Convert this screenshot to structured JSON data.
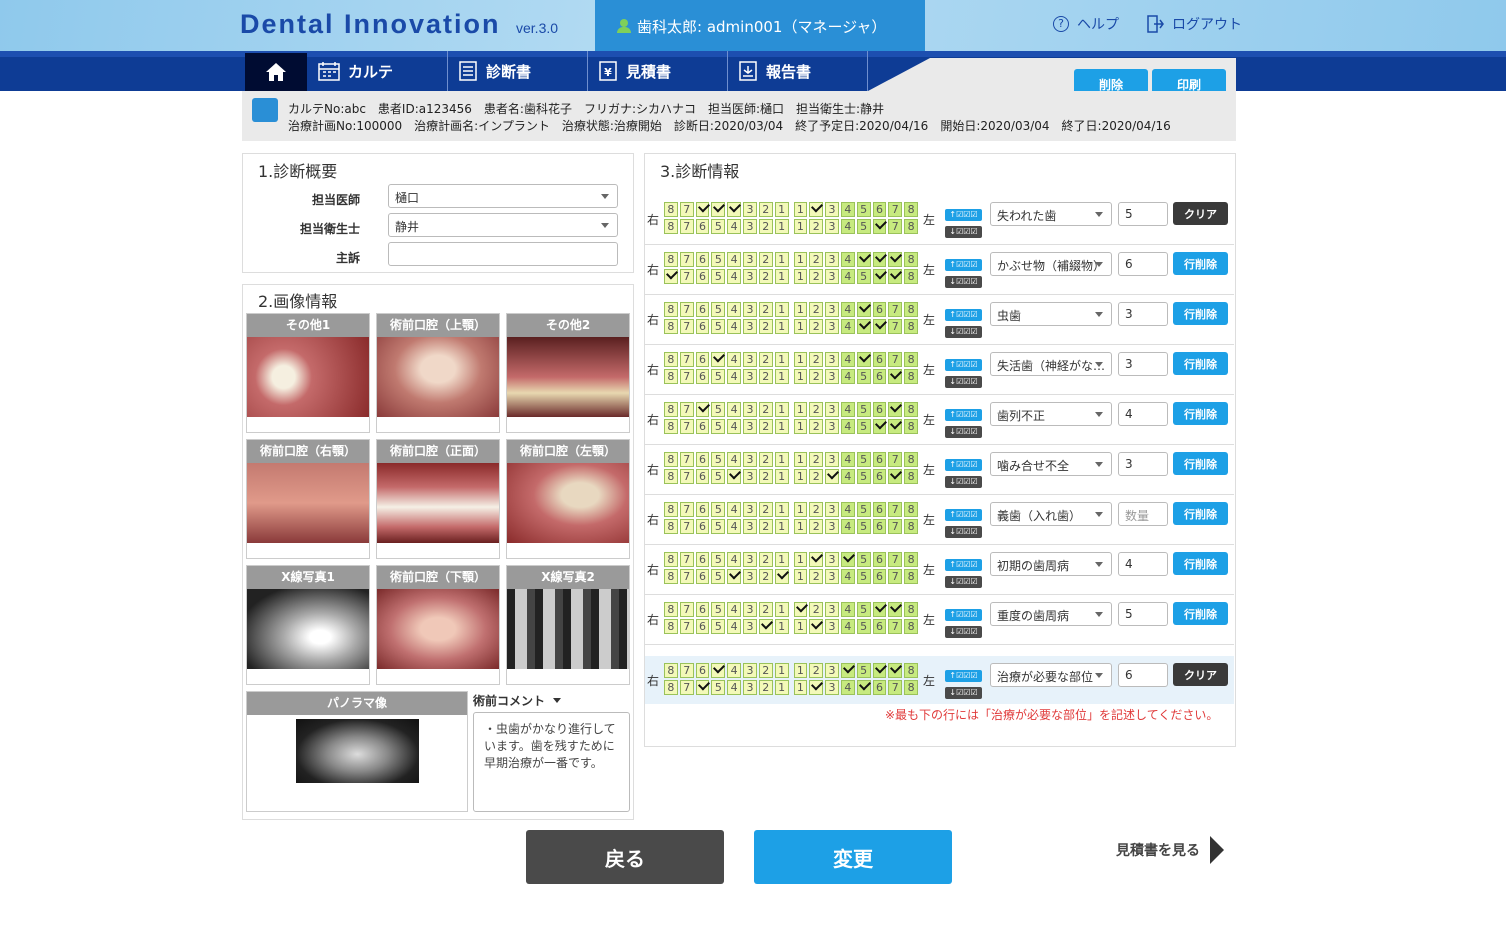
{
  "app": {
    "logo": "Dental Innovation",
    "version": "ver.3.0"
  },
  "user": {
    "label": "歯科太郎: admin001（マネージャ）"
  },
  "top_links": {
    "help": "ヘルプ",
    "logout": "ログアウト"
  },
  "nav": {
    "karte": "カルテ",
    "diagnosis": "診断書",
    "estimate": "見積書",
    "report": "報告書"
  },
  "actions": {
    "delete": "削除",
    "print": "印刷"
  },
  "info": {
    "line1": "カルテNo:abc　患者ID:a123456　患者名:歯科花子　フリガナ:シカハナコ　担当医師:樋口　担当衛生士:静井",
    "line2": "治療計画No:100000　治療計画名:インプラント　治療状態:治療開始　診断日:2020/03/04　終了予定日:2020/04/16　開始日:2020/03/04　終了日:2020/04/16"
  },
  "overview": {
    "title": "1.診断概要",
    "doctor_label": "担当医師",
    "doctor_value": "樋口",
    "hygienist_label": "担当衛生士",
    "hygienist_value": "静井",
    "complaint_label": "主訴",
    "complaint_value": ""
  },
  "images": {
    "title": "2.画像情報",
    "cards": [
      "その他1",
      "術前口腔（上顎）",
      "その他2",
      "術前口腔（右顎）",
      "術前口腔（正面）",
      "術前口腔（左顎）",
      "X線写真1",
      "術前口腔（下顎）",
      "X線写真2"
    ],
    "panorama": "パノラマ像",
    "comment_label": "術前コメント",
    "comment": "・虫歯がかなり進行しています。歯を残すために早期治療が一番です。"
  },
  "diag": {
    "title": "3.診断情報",
    "right": "右",
    "left": "左",
    "up": "↑☑☑☑",
    "down": "↓☑☑☑",
    "note": "※最も下の行には「治療が必要な部位」を記述してください。",
    "rows": [
      {
        "type": "失われた歯",
        "qty": "5",
        "action": "クリア"
      },
      {
        "type": "かぶせ物（補綴物）",
        "qty": "6",
        "action": "行削除"
      },
      {
        "type": "虫歯",
        "qty": "3",
        "action": "行削除"
      },
      {
        "type": "失活歯（神経がな…",
        "qty": "3",
        "action": "行削除"
      },
      {
        "type": "歯列不正",
        "qty": "4",
        "action": "行削除"
      },
      {
        "type": "噛み合せ不全",
        "qty": "3",
        "action": "行削除"
      },
      {
        "type": "義歯（入れ歯）",
        "qty": "数量",
        "action": "行削除"
      },
      {
        "type": "初期の歯周病",
        "qty": "4",
        "action": "行削除"
      },
      {
        "type": "重度の歯周病",
        "qty": "5",
        "action": "行削除"
      },
      {
        "type": "治療が必要な部位",
        "qty": "6",
        "action": "クリア"
      }
    ]
  },
  "bottom": {
    "back": "戻る",
    "change": "変更",
    "view_estimate": "見積書を見る"
  }
}
